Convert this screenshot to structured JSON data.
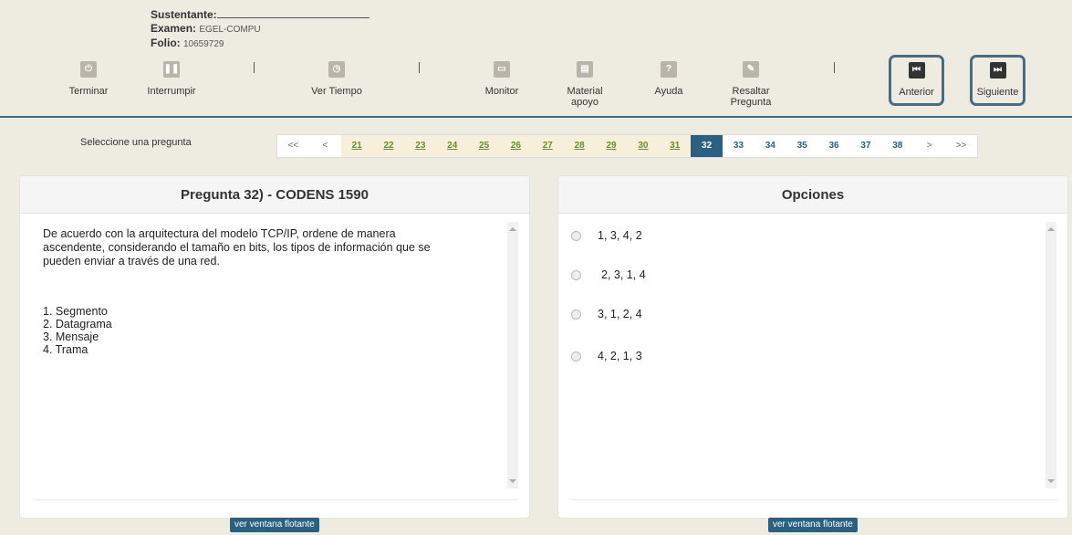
{
  "header": {
    "sustentante_label": "Sustentante:",
    "examen_label": "Examen:",
    "examen_value": "EGEL-COMPU",
    "folio_label": "Folio:",
    "folio_value": "10659729"
  },
  "toolbar": {
    "terminar": "Terminar",
    "interrumpir": "Interrumpir",
    "ver_tiempo": "Ver Tiempo",
    "monitor": "Monitor",
    "material_line1": "Material",
    "material_line2": "apoyo",
    "ayuda": "Ayuda",
    "resaltar_line1": "Resaltar",
    "resaltar_line2": "Pregunta",
    "anterior": "Anterior",
    "siguiente": "Siguiente"
  },
  "pager": {
    "label": "Seleccione una pregunta",
    "first": "<<",
    "prev": "<",
    "answered": [
      "21",
      "22",
      "23",
      "24",
      "25",
      "26",
      "27",
      "28",
      "29",
      "30",
      "31"
    ],
    "current": "32",
    "unanswered": [
      "33",
      "34",
      "35",
      "36",
      "37",
      "38"
    ],
    "next": ">",
    "last": ">>"
  },
  "question": {
    "title": "Pregunta 32) - CODENS 1590",
    "text": "De acuerdo con la arquitectura del modelo TCP/IP, ordene de manera ascendente, considerando el tamaño en bits, los tipos de información que se pueden enviar a través de una red.",
    "items": [
      "1. Segmento",
      "2. Datagrama",
      "3. Mensaje",
      "4. Trama"
    ],
    "float_button": "ver ventana flotante"
  },
  "options": {
    "title": "Opciones",
    "choices": [
      "1, 3, 4, 2",
      "2, 3, 1, 4",
      "3, 1, 2, 4",
      "4, 2, 1, 3"
    ],
    "float_button": "ver ventana flotante"
  }
}
